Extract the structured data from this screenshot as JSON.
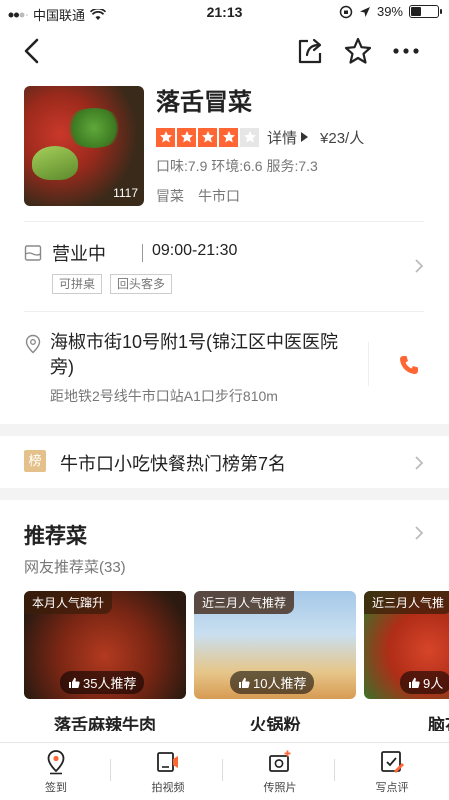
{
  "status_bar": {
    "carrier": "中国联通",
    "time": "21:13",
    "battery": "39%"
  },
  "shop": {
    "name": "落舌冒菜",
    "photo_count": "1117",
    "rating_stars": 4,
    "detail_label": "详情",
    "price": "¥23/人",
    "scores": "口味:7.9 环境:6.6 服务:7.3",
    "tags": [
      "冒菜",
      "牛市口"
    ]
  },
  "hours": {
    "status": "营业中",
    "time": "09:00-21:30",
    "badges": [
      "可拼桌",
      "回头客多"
    ]
  },
  "address": {
    "text": "海椒市街10号附1号(锦江区中医医院旁)",
    "subway": "距地铁2号线牛市口站A1口步行810m"
  },
  "rank": {
    "icon_label": "榜",
    "text": "牛市口小吃快餐热门榜第7名"
  },
  "recommend": {
    "title": "推荐菜",
    "subtitle": "网友推荐菜(33)",
    "dishes": [
      {
        "badge": "本月人气蹿升",
        "likes": "35人推荐",
        "name": "落舌麻辣牛肉"
      },
      {
        "badge": "近三月人气推荐",
        "likes": "10人推荐",
        "name": "火锅粉"
      },
      {
        "badge": "近三月人气推",
        "likes": "9人",
        "name": "脑花"
      }
    ]
  },
  "tabbar": {
    "items": [
      "签到",
      "拍视频",
      "传照片",
      "写点评"
    ]
  },
  "colors": {
    "accent": "#ff6633",
    "star_empty": "#e6e6e6",
    "text_primary": "#222222",
    "text_secondary": "#777777"
  }
}
